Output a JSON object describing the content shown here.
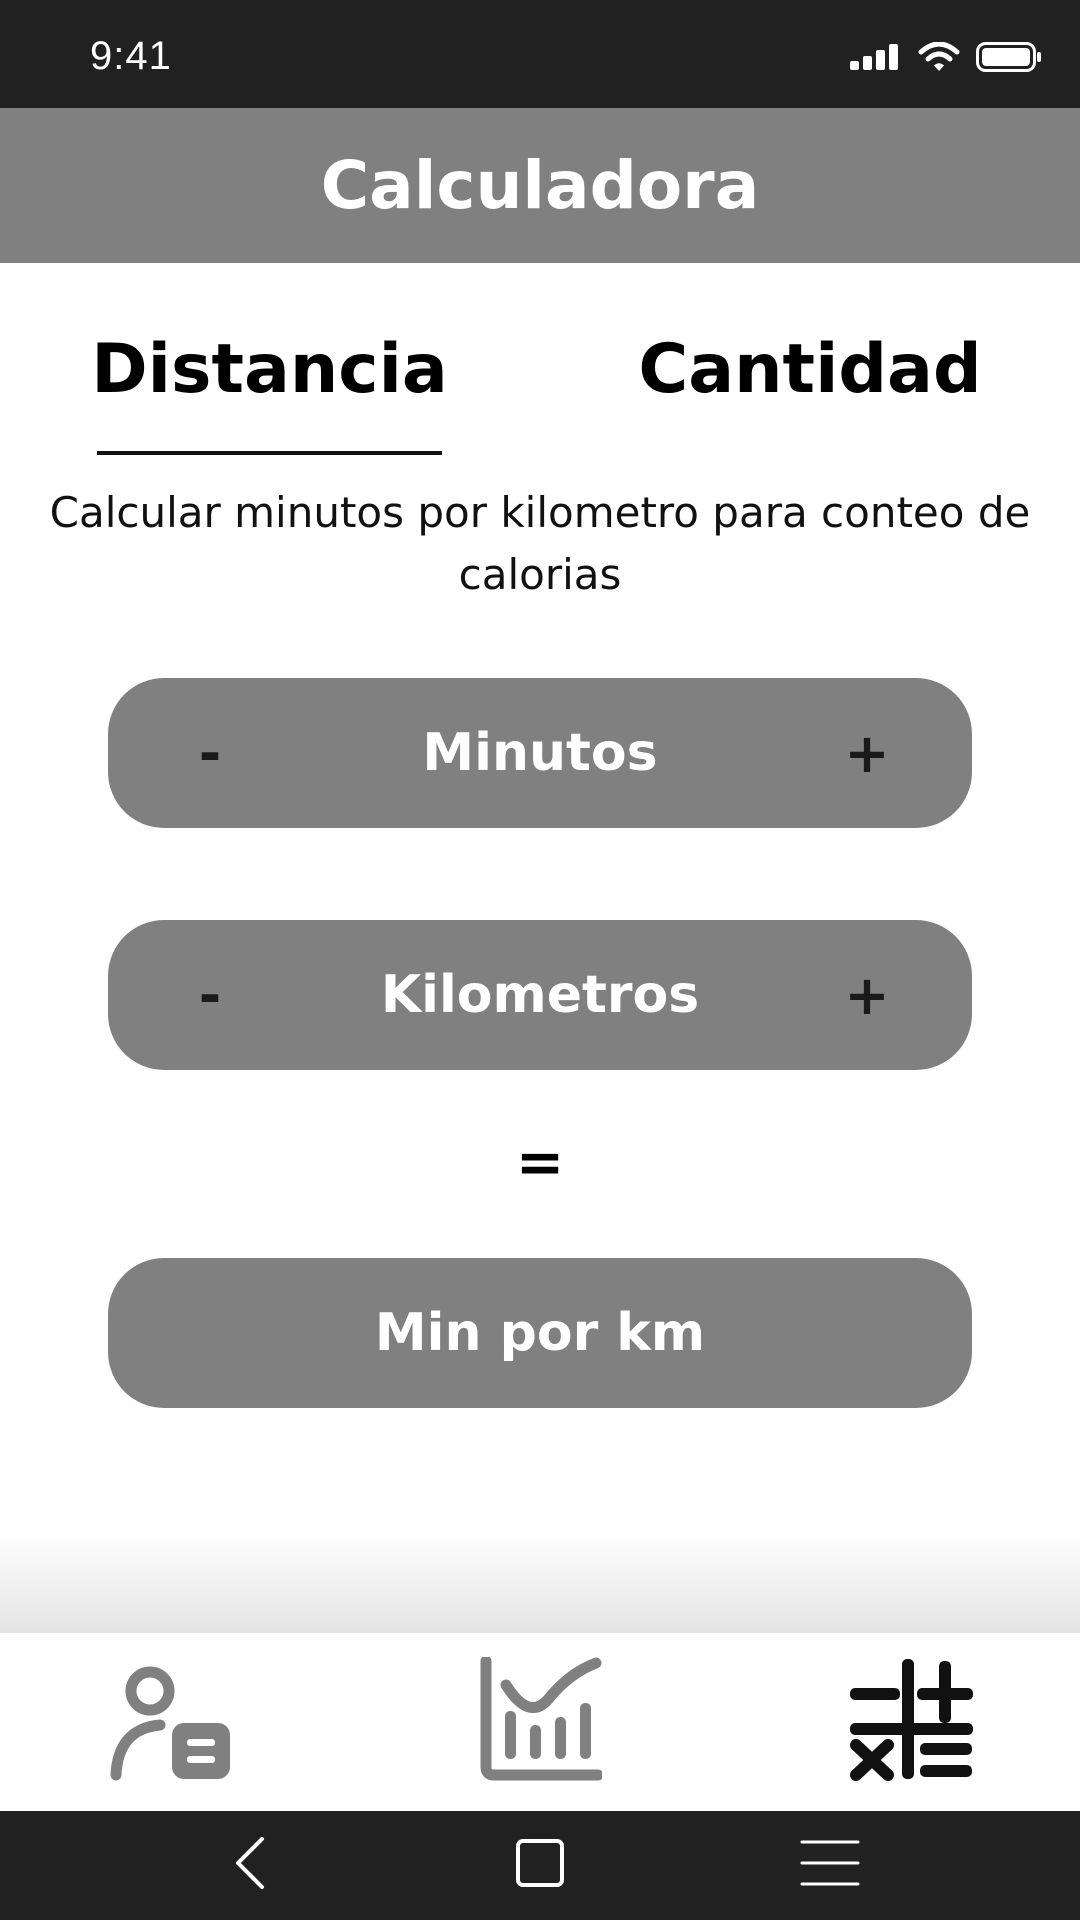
{
  "status_bar": {
    "time": "9:41"
  },
  "header": {
    "title": "Calculadora"
  },
  "tabs": [
    {
      "label": "Distancia",
      "active": true
    },
    {
      "label": "Cantidad",
      "active": false
    }
  ],
  "description": "Calcular minutos por kilometro para conteo de calorias",
  "fields": {
    "minutos": {
      "label": "Minutos",
      "minus": "-",
      "plus": "+"
    },
    "kilometros": {
      "label": "Kilometros",
      "minus": "-",
      "plus": "+"
    }
  },
  "equals": "=",
  "result": {
    "label": "Min por km"
  },
  "bottom_nav": [
    {
      "icon": "profile-badge-icon",
      "active": false
    },
    {
      "icon": "bar-chart-icon",
      "active": false
    },
    {
      "icon": "calculator-icon",
      "active": true
    }
  ],
  "colors": {
    "header": "#808080",
    "pill": "#808080",
    "system_bar": "#212121",
    "inactive_icon": "#808080",
    "active_icon": "#111111"
  }
}
